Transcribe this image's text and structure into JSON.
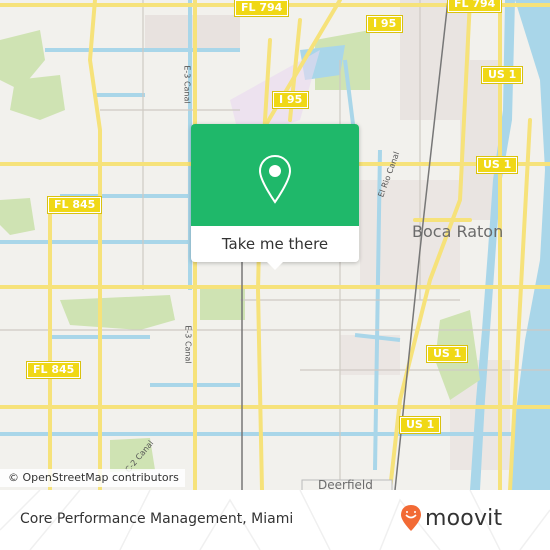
{
  "map": {
    "city_label": "Boca Raton",
    "city_label_partial": "Deerfield",
    "shields": {
      "fl794_left": "FL 794",
      "fl794_right": "FL 794",
      "i95_top": "I 95",
      "i95_mid": "I 95",
      "us1_top": "US 1",
      "us1_mid": "US 1",
      "us1_lower": "US 1",
      "us1_bottom": "US 1",
      "fl845_top": "FL 845",
      "fl845_bottom": "FL 845"
    },
    "canals": {
      "e3_top": "E-3 Canal",
      "e3_bottom": "E-3 Canal",
      "el_rio": "El Rio Canal",
      "c2": "C-2 Canal"
    },
    "attribution": "© OpenStreetMap contributors"
  },
  "popup": {
    "icon": "location-pin-icon",
    "action_label": "Take me there",
    "color": "#1fb86a"
  },
  "footer": {
    "title": "Core Performance Management, Miami",
    "brand": "moovit",
    "brand_color": "#f26a35"
  }
}
